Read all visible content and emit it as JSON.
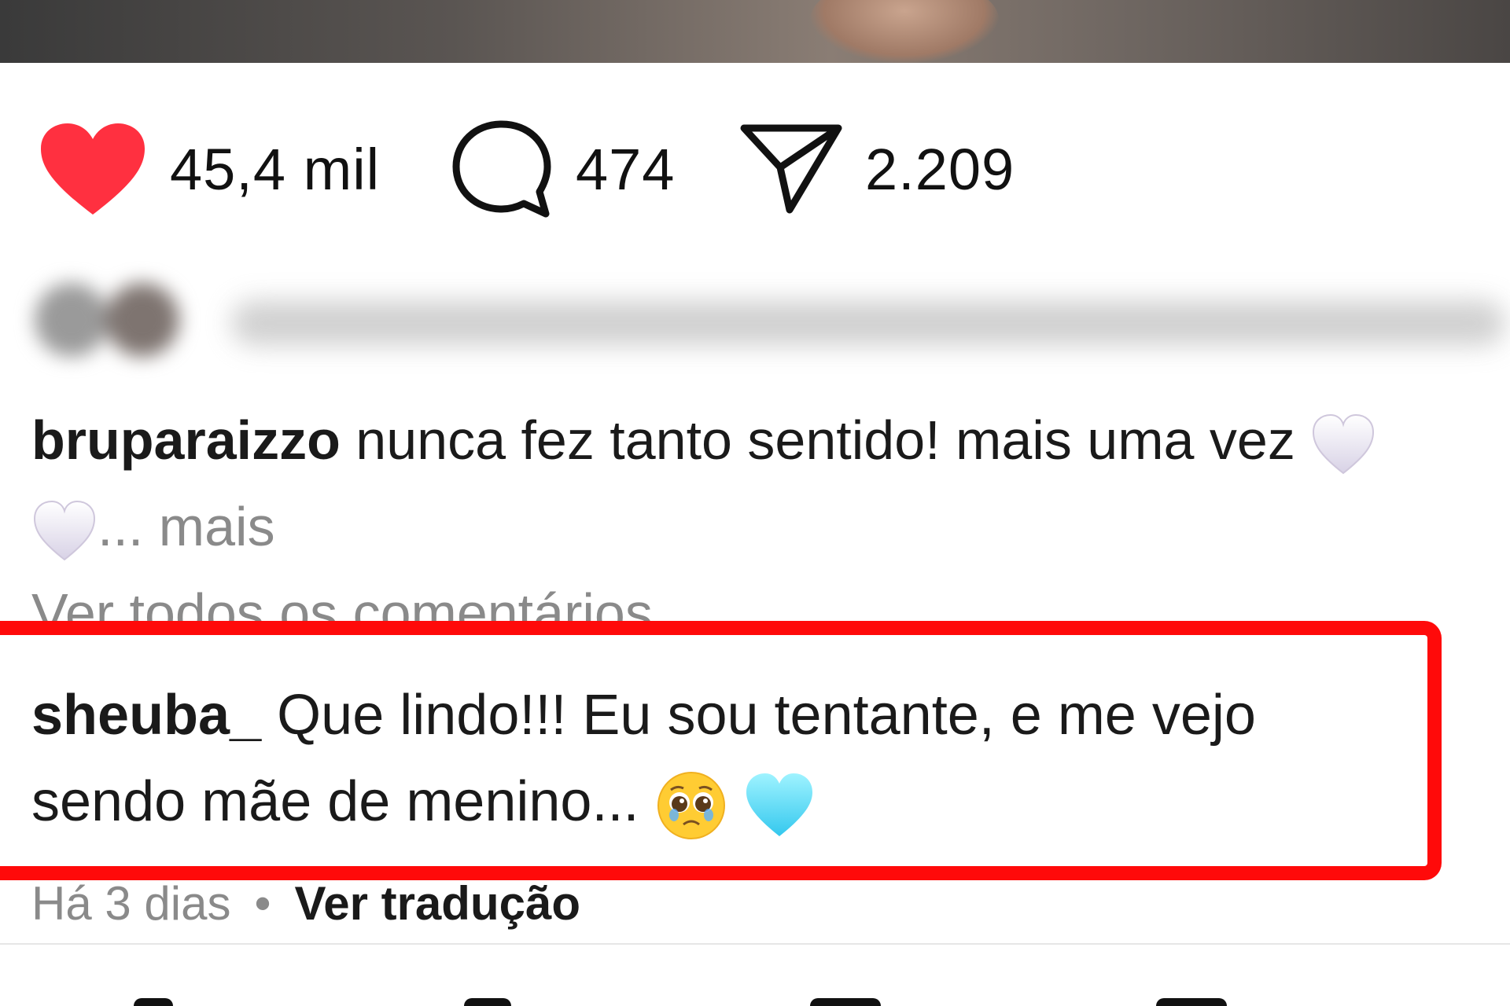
{
  "post": {
    "stats": {
      "likes": "45,4 mil",
      "comments": "474",
      "shares": "2.209"
    },
    "caption": {
      "username": "bruparaizzo",
      "text": "nunca fez tanto sentido! mais uma vez",
      "more_label": "... mais"
    },
    "view_all_comments": "Ver todos os comentários",
    "highlighted_comment": {
      "username": "sheuba_",
      "text": "Que lindo!!! Eu sou tentante, e me vejo sendo mãe de menino...",
      "time": "Há 3 dias",
      "separator": "•",
      "translate_label": "Ver tradução"
    }
  },
  "colors": {
    "like_red": "#ff3040",
    "highlight_red": "#ff0a0a",
    "muted_text": "#8a8a8a"
  },
  "icons": {
    "like": "heart-icon",
    "comment": "comment-bubble-icon",
    "share": "paper-plane-icon",
    "caption_emoji": "white-heart-emoji-icon",
    "comment_emoji_1": "pleading-face-emoji-icon",
    "comment_emoji_2": "light-blue-heart-emoji-icon"
  }
}
